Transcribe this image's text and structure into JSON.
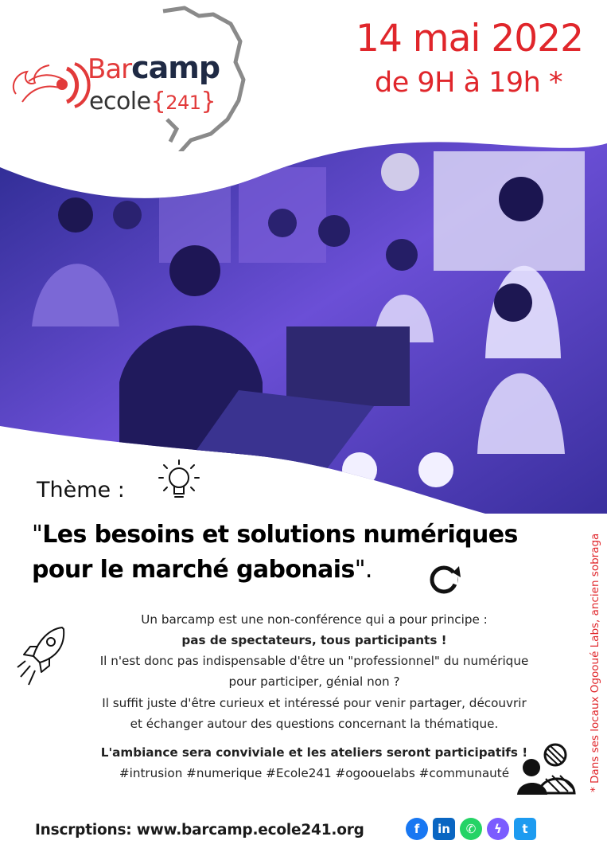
{
  "logo": {
    "bar": "Bar",
    "camp": "camp",
    "ecole": "ecole",
    "brace_open": "{",
    "number": "241",
    "brace_close": "}"
  },
  "event": {
    "date": "14 mai 2022",
    "time": "de 9H à 19h *"
  },
  "theme": {
    "label": "Thème :",
    "title_open_quote": "\"",
    "title_line1": "Les besoins et solutions numériques",
    "title_line2": "pour le marché gabonais",
    "title_close": "\"."
  },
  "description": {
    "line1": "Un barcamp est une non-conférence qui a pour principe :",
    "line2": "pas de spectateurs, tous participants !",
    "line3": "Il n'est donc pas indispensable d'être un \"professionnel\" du numérique",
    "line4": "pour participer, génial non ?",
    "line5": "Il suffit juste d'être curieux et intéressé pour venir partager, découvrir",
    "line6": "et échanger autour des questions concernant la thématique.",
    "ambiance": "L'ambiance sera conviviale et les ateliers seront participatifs !",
    "hashtags": "#intrusion #numerique #Ecole241 #ogoouelabs #communauté"
  },
  "side_note": "* Dans ses locaux Ogooué Labs, ancien sobraga",
  "footer": {
    "registration": "Inscrptions: www.barcamp.ecole241.org"
  },
  "socials": [
    {
      "icon": "facebook-icon",
      "glyph": "f",
      "color": "#1877f2"
    },
    {
      "icon": "linkedin-icon",
      "glyph": "in",
      "color": "#0a66c2"
    },
    {
      "icon": "whatsapp-icon",
      "glyph": "✆",
      "color": "#25d366"
    },
    {
      "icon": "messenger-icon",
      "glyph": "ϟ",
      "color": "#7b5cff"
    },
    {
      "icon": "twitter-icon",
      "glyph": "t",
      "color": "#1d9bf0"
    }
  ],
  "colors": {
    "accent_red": "#e0262b",
    "photo_tint": "#4a3fb8",
    "logo_navy": "#1f2a44"
  }
}
